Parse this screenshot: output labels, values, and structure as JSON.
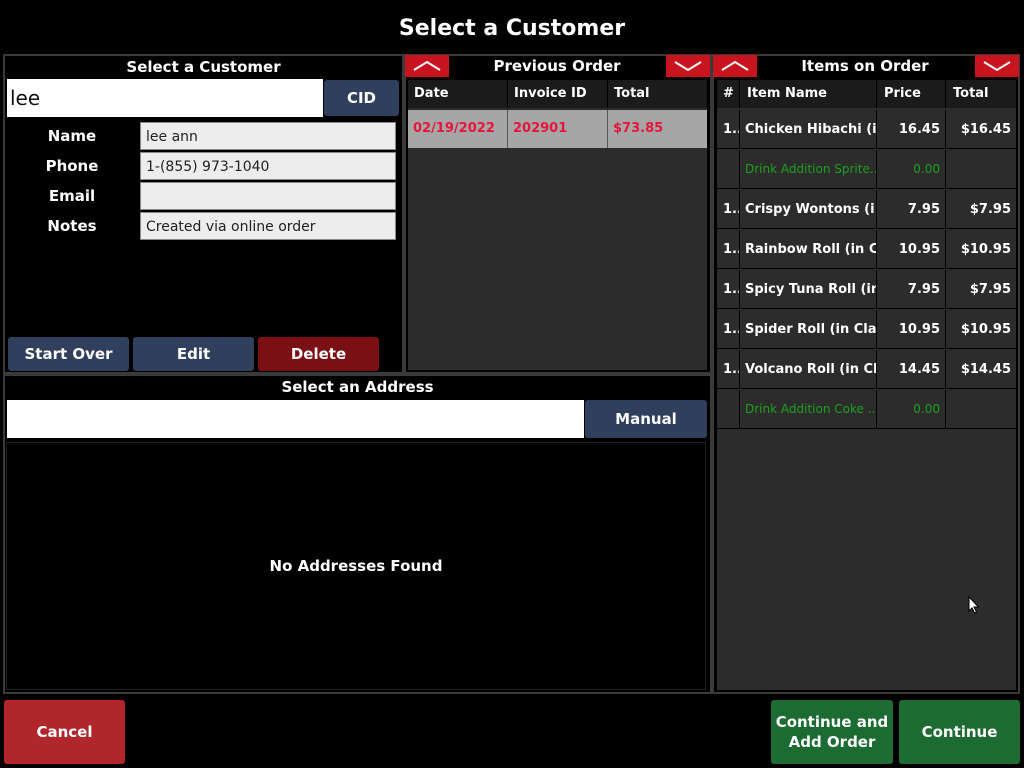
{
  "page": {
    "title": "Select a Customer"
  },
  "customer": {
    "header": "Select a Customer",
    "search_value": "lee",
    "cid_label": "CID",
    "fields": [
      {
        "label": "Name",
        "value": "lee ann"
      },
      {
        "label": "Phone",
        "value": "1-(855) 973-1040"
      },
      {
        "label": "Email",
        "value": ""
      },
      {
        "label": "Notes",
        "value": "Created via online order"
      }
    ],
    "buttons": {
      "start_over": "Start Over",
      "edit": "Edit",
      "delete": "Delete"
    }
  },
  "previous_order": {
    "header": "Previous Order",
    "columns": [
      "Date",
      "Invoice ID",
      "Total"
    ],
    "rows": [
      {
        "date": "02/19/2022",
        "invoice": "202901",
        "total": "$73.85"
      }
    ]
  },
  "items": {
    "header": "Items on Order",
    "columns": [
      "#",
      "Item Name",
      "Price",
      "Total"
    ],
    "rows": [
      {
        "num": "1...",
        "name": "Chicken Hibachi (i...",
        "price": "16.45",
        "total": "$16.45",
        "addition": false
      },
      {
        "num": "",
        "name": "Drink Addition Sprite...",
        "price": "0.00",
        "total": "",
        "addition": true
      },
      {
        "num": "1...",
        "name": "Crispy Wontons (i...",
        "price": "7.95",
        "total": "$7.95",
        "addition": false
      },
      {
        "num": "1...",
        "name": "Rainbow Roll (in C...",
        "price": "10.95",
        "total": "$10.95",
        "addition": false
      },
      {
        "num": "1...",
        "name": "Spicy Tuna Roll (in...",
        "price": "7.95",
        "total": "$7.95",
        "addition": false
      },
      {
        "num": "1...",
        "name": "Spider Roll (in Cla...",
        "price": "10.95",
        "total": "$10.95",
        "addition": false
      },
      {
        "num": "1...",
        "name": "Volcano Roll (in Cl...",
        "price": "14.45",
        "total": "$14.45",
        "addition": false
      },
      {
        "num": "",
        "name": "Drink Addition Coke ...",
        "price": "0.00",
        "total": "",
        "addition": true
      }
    ]
  },
  "address": {
    "header": "Select an Address",
    "search_value": "",
    "manual_label": "Manual",
    "empty_text": "No Addresses Found"
  },
  "footer": {
    "cancel": "Cancel",
    "continue_add_line1": "Continue and",
    "continue_add_line2": "Add Order",
    "continue": "Continue"
  },
  "colors": {
    "accent_red": "#c8141e",
    "invoice_text": "#e8143c",
    "addition_text": "#1ea01e",
    "button_blue": "#2f3f5c",
    "button_green": "#1c6b33"
  }
}
